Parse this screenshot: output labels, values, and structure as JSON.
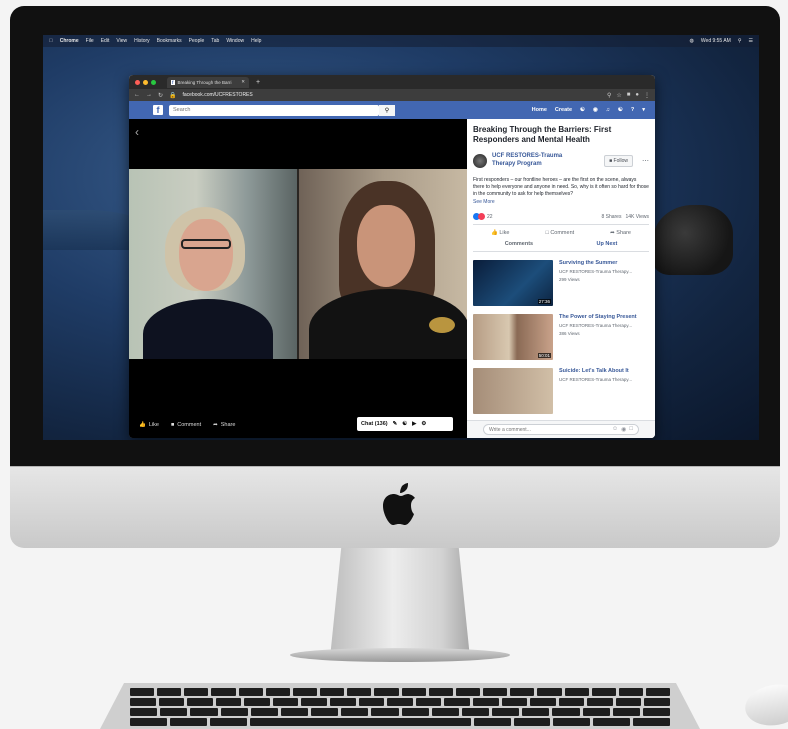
{
  "menubar": {
    "items": [
      "Chrome",
      "File",
      "Edit",
      "View",
      "History",
      "Bookmarks",
      "People",
      "Tab",
      "Window",
      "Help"
    ],
    "clock": "Wed 9:55 AM"
  },
  "browser": {
    "tab_title": "Breaking Through the Barri",
    "url": "facebook.com/UCFRESTORES"
  },
  "facebook": {
    "logo": "f",
    "search_placeholder": "Search",
    "nav": [
      "Home",
      "Create"
    ]
  },
  "video": {
    "actions": {
      "like": "Like",
      "comment": "Comment",
      "share": "Share"
    },
    "chat_label": "Chat (136)"
  },
  "post": {
    "title": "Breaking Through the Barriers: First Responders and Mental Health",
    "author": "UCF RESTORES-Trauma Therapy Program",
    "follow": "Follow",
    "description": "First responders – our frontline heroes – are the first on the scene, always there to help everyone and anyone in need. So, why is it often so hard for those in the community to ask for help themselves?",
    "see_more": "See More",
    "reaction_count": "22",
    "shares": "8 Shares",
    "views": "14K Views",
    "buttons": {
      "like": "Like",
      "comment": "Comment",
      "share": "Share"
    },
    "tabs": {
      "comments": "Comments",
      "upnext": "Up Next"
    }
  },
  "up_next": [
    {
      "title": "Surviving the Summer",
      "channel": "UCF RESTORES-Trauma Therapy...",
      "views": "299 Views",
      "duration": "27:36"
    },
    {
      "title": "The Power of Staying Present",
      "channel": "UCF RESTORES-Trauma Therapy...",
      "views": "386 Views",
      "duration": "50:01"
    },
    {
      "title": "Suicide: Let's Talk About It",
      "channel": "UCF RESTORES-Trauma Therapy...",
      "views": "",
      "duration": ""
    }
  ],
  "comment_placeholder": "Write a comment...",
  "colors": {
    "facebook_blue": "#4267b2",
    "link_blue": "#385898",
    "like_blue": "#1877f2",
    "love_red": "#f33e58"
  }
}
